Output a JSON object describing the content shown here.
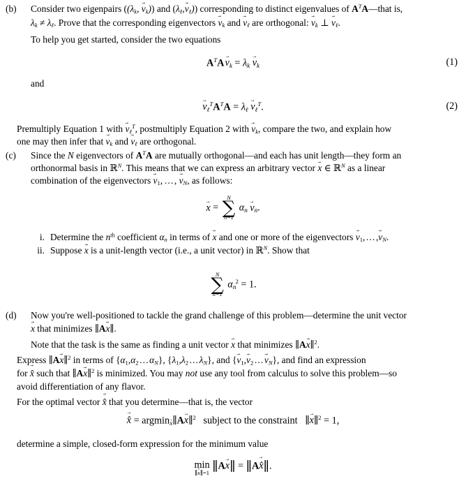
{
  "document": {
    "type": "math-homework-problem",
    "parts": [
      {
        "id": "b",
        "label": "(b)",
        "paragraphs": [
          "Consider two eigenpairs (λk, v⃗k) and (λℓ, v⃗ℓ) corresponding to distinct eigenvalues of A^T A—that is, λk ≠ λℓ. Prove that the corresponding eigenvectors v⃗k and v⃗ℓ are orthogonal: v⃗k ⊥ v⃗ℓ.",
          "To help you get started, consider the two equations",
          "and",
          "Premultiply Equation 1 with v⃗ℓ^T, postmultiply Equation 2 with v⃗k, compare the two, and explain how one may then infer that v⃗k and v⃗ℓ are orthogonal."
        ],
        "line1a": "Consider two eigenpairs (",
        "line1b": ") and (",
        "line1c": ") corresponding to distinct eigenvalues of ",
        "line1d": "—that is,",
        "line2a": ". Prove that the corresponding eigenvectors ",
        "line2b": " and ",
        "line2c": " are orthogonal: ",
        "line2d": ".",
        "line3": "To help you get started, consider the two equations",
        "and_word": "and",
        "line4a": "Premultiply Equation 1 with ",
        "line4b": ", postmultiply Equation 2 with ",
        "line4c": ", compare the two, and explain how",
        "line5a": "one may then infer that ",
        "line5b": " and ",
        "line5c": " are orthogonal."
      },
      {
        "id": "c",
        "label": "(c)",
        "line1a": "Since the ",
        "line1b": " eigenvectors of ",
        "line1c": " are mutually orthogonal—and each has unit length—they form an",
        "line2a": "orthonormal basis in ",
        "line2b": ".  This means that we can express an arbitrary vector ",
        "line2c": " ∈ ",
        "line2d": " as a linear",
        "line3a": "combination of the eigenvectors ",
        "line3b": ", as follows:",
        "subitems": [
          {
            "marker": "i.",
            "text_a": "Determine the ",
            "text_b": " coefficient ",
            "text_c": " in terms of ",
            "text_d": " and one or more of the eigenvectors ",
            "text_e": "."
          },
          {
            "marker": "ii.",
            "text_a": "Suppose ",
            "text_b": " is a unit-length vector (i.e., a unit vector) in ",
            "text_c": ". Show that"
          }
        ]
      },
      {
        "id": "d",
        "label": "(d)",
        "line1": "Now you're well-positioned to tackle the grand challenge of this problem—determine the unit vector",
        "line2a": " that minimizes ",
        "line2b": ".",
        "line3a": "Note that the task is the same as finding a unit vector ",
        "line3b": " that minimizes ",
        "line3c": ".",
        "line4a": "Express ",
        "line4b": " in terms of {",
        "line4c": "}, {",
        "line4d": "}, and {",
        "line4e": "}, and find an expression",
        "line5a": "for ",
        "line5b": " such that ",
        "line5c": " is minimized. You may ",
        "line5d": "not",
        "line5e": " use any tool from calculus to solve this problem—so",
        "line6": "avoid differentiation of any flavor.",
        "line7a": "For the optimal vector ",
        "line7b": " that you determine—that is, the vector",
        "line8": "determine a simple, closed-form expression for the minimum value"
      }
    ],
    "equations": [
      {
        "number": "(1)",
        "latex": "A^T A v⃗_k = λ_k v⃗_k"
      },
      {
        "number": "(2)",
        "latex": "v⃗_ℓ^T A^T A = λ_ℓ v⃗_ℓ^T ."
      },
      {
        "number": "",
        "latex": "x⃗ = Σ_{n=1}^{N} α_n v⃗_n ."
      },
      {
        "number": "",
        "latex": "Σ_{n=1}^{N} α_n^2 = 1 ."
      },
      {
        "number": "",
        "latex": "x⃗̂ = argmin_{x⃗} ||A x⃗||^2   subject to the constraint   ||x⃗||^2 = 1,"
      },
      {
        "number": "",
        "latex": "min_{||x⃗||=1} ||A x⃗|| = ||A x⃗̂|| ."
      }
    ],
    "symbols": {
      "lambda": "λ",
      "alpha": "α",
      "ell": "ℓ",
      "k": "k",
      "n": "n",
      "N": "N",
      "sum": "∑",
      "neq": "≠",
      "perp": "⊥",
      "in": "∈",
      "equals": "=",
      "ellipsis": "…",
      "blackboard_R": "ℝ",
      "A": "A",
      "T": "T",
      "v": "v",
      "x": "x",
      "one": "1",
      "two": "2",
      "subject_text": "subject to the constraint",
      "argmin": "argmin",
      "min": "min",
      "th": "th",
      "n_eq_1": "n=1"
    },
    "constraint_text": "subject to the constraint",
    "equation_numbers": {
      "eq1": "(1)",
      "eq2": "(2)"
    }
  }
}
